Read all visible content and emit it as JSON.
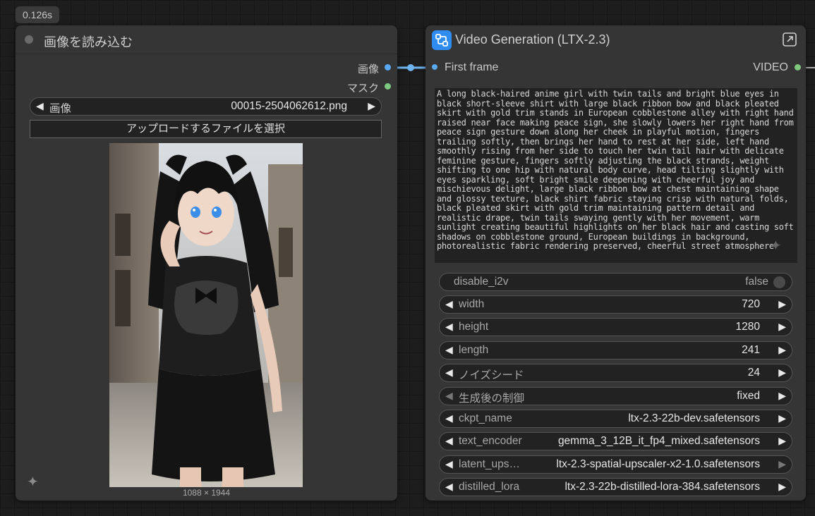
{
  "timer": "0.126s",
  "left_node": {
    "title": "画像を読み込む",
    "outputs": [
      {
        "label": "画像",
        "color": "#5aa9f0"
      },
      {
        "label": "マスク",
        "color": "#7ec97e"
      }
    ],
    "image_combo": {
      "label": "画像",
      "value": "00015-2504062612.png"
    },
    "upload_label": "アップロードするファイルを選択",
    "dimensions": "1088 × 1944"
  },
  "right_node": {
    "title": "Video Generation (LTX-2.3)",
    "input": {
      "label": "First frame"
    },
    "output": {
      "label": "VIDEO",
      "color": "#7ec97e"
    },
    "prompt": "A long black-haired anime girl with twin tails and bright blue eyes in black short-sleeve shirt with large black ribbon bow and black pleated skirt with gold trim stands in European cobblestone alley with right hand raised near face making peace sign, she slowly lowers her right hand from peace sign gesture down along her cheek in playful motion, fingers trailing softly, then brings her hand to rest at her side, left hand smoothly rising from her side to touch her twin tail hair with delicate feminine gesture, fingers softly adjusting the black strands, weight shifting to one hip with natural body curve, head tilting slightly with eyes sparkling, soft bright smile deepening with cheerful joy and mischievous delight, large black ribbon bow at chest maintaining shape and glossy texture, black shirt fabric staying crisp with natural folds, black pleated skirt with gold trim maintaining pattern detail and realistic drape, twin tails swaying gently with her movement, warm sunlight creating beautiful highlights on her black hair and casting soft shadows on cobblestone ground, European buildings in background, photorealistic fabric rendering preserved, cheerful street atmosphere",
    "toggle": {
      "label": "disable_i2v",
      "value": "false"
    },
    "widgets": [
      {
        "label": "width",
        "value": "720"
      },
      {
        "label": "height",
        "value": "1280"
      },
      {
        "label": "length",
        "value": "241"
      },
      {
        "label": "ノイズシード",
        "value": "24"
      },
      {
        "label": "生成後の制御",
        "value": "fixed"
      },
      {
        "label": "ckpt_name",
        "value": "ltx-2.3-22b-dev.safetensors"
      },
      {
        "label": "text_encoder",
        "value": "gemma_3_12B_it_fp4_mixed.safetensors"
      },
      {
        "label": "latent_ups…",
        "value": "ltx-2.3-spatial-upscaler-x2-1.0.safetensors"
      },
      {
        "label": "distilled_lora",
        "value": "ltx-2.3-22b-distilled-lora-384.safetensors"
      }
    ]
  }
}
